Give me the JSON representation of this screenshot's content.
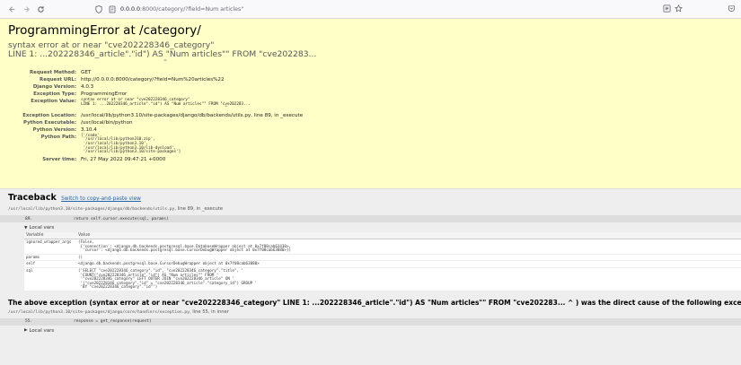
{
  "browser": {
    "url_host": "0.0.0.0",
    "url_path": ":8000/category/?field=Num articles\""
  },
  "summary": {
    "title": "ProgrammingError at /category/",
    "exception_line1": "syntax error at or near \"cve202228346_category\"",
    "exception_line2": "LINE 1: ...202228346_article\".\"id\") AS \"Num articles\"\" FROM \"cve202283...",
    "caret": "^",
    "rows": [
      {
        "label": "Request Method:",
        "value": "GET"
      },
      {
        "label": "Request URL:",
        "value": "http://0.0.0.0:8000/category/?field=Num%20articles%22"
      },
      {
        "label": "Django Version:",
        "value": "4.0.3"
      },
      {
        "label": "Exception Type:",
        "value": "ProgrammingError"
      }
    ],
    "exception_value_label": "Exception Value:",
    "exception_value": "syntax error at or near \"cve202228346_category\"\nLINE 1: ...202228346_article\".\"id\") AS \"Num articles\"\" FROM \"cve202283...\n                                                              ^",
    "rows2": [
      {
        "label": "Exception Location:",
        "value": "/usr/local/lib/python3.10/site-packages/django/db/backends/utils.py, line 89, in _execute"
      },
      {
        "label": "Python Executable:",
        "value": "/usr/local/bin/python"
      },
      {
        "label": "Python Version:",
        "value": "3.10.4"
      }
    ],
    "python_path_label": "Python Path:",
    "python_path": "['/code',\n '/usr/local/lib/python310.zip',\n '/usr/local/lib/python3.10',\n '/usr/local/lib/python3.10/lib-dynload',\n '/usr/local/lib/python3.10/site-packages']",
    "server_time_label": "Server time:",
    "server_time": "Fri, 27 May 2022 09:47:21 +0000"
  },
  "traceback": {
    "heading": "Traceback",
    "switch_link": "Switch to copy-and-paste view",
    "frame1": {
      "file": "/usr/local/lib/python3.10/site-packages/django/db/backends/utils.py",
      "rest": ", line 89, in _execute",
      "line_no": "89.",
      "code": "return self.cursor.execute(sql, params)",
      "local_vars_label": "Local vars",
      "col_variable": "Variable",
      "col_value": "Value",
      "vars": [
        {
          "name": "ignored_wrapper_args",
          "value": "(False,\n {'connection': <django.db.backends.postgresql.base.DatabaseWrapper object at 0x7f08cab63430>,\n  'cursor': <django.db.backends.postgresql.base.CursorDebugWrapper object at 0x7f08cab63880>})"
        },
        {
          "name": "params",
          "value": "()"
        },
        {
          "name": "self",
          "value": "<django.db.backends.postgresql.base.CursorDebugWrapper object at 0x7f08cab63880>"
        },
        {
          "name": "sql",
          "value": "('SELECT \"cve202228346_category\".\"id\", \"cve202228346_category\".\"title\", '\n 'COUNT(\"cve202228346_article\".\"id\") AS \"Num articles\"\" FROM '\n '\"cve202228346_category\" LEFT OUTER JOIN \"cve202228346_article\" ON '\n '(\"cve202228346_category\".\"id\" = \"cve202228346_article\".\"category_id\") GROUP '\n 'BY \"cve202228346_category\".\"id\"')"
        }
      ]
    },
    "cause_text": "The above exception (syntax error at or near \"cve202228346_category\" LINE 1: ...202228346_article\".\"id\") AS \"Num articles\"\" FROM \"cve202283... ^ ) was the direct cause of the following exception:",
    "frame2": {
      "file": "/usr/local/lib/python3.10/site-packages/django/core/handlers/exception.py",
      "rest": ", line 55, in inner",
      "line_no": "55.",
      "code": "response = get_response(request)",
      "local_vars_label": "Local vars"
    }
  },
  "colors": {
    "summary_bg": "#ffffc8",
    "traceback_bg": "#eeeeee",
    "link": "#2564a6"
  }
}
